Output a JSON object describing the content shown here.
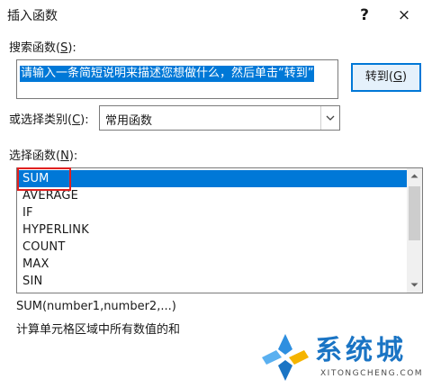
{
  "window": {
    "title": "插入函数",
    "help_glyph": "?",
    "close_glyph": "×"
  },
  "search": {
    "label": "搜索函数(",
    "mnemonic": "S",
    "label_end": "):",
    "value": "请输入一条简短说明来描述您想做什么，然后单击“转到”",
    "goto_label": "转到(",
    "goto_mnemonic": "G",
    "goto_end": ")"
  },
  "category": {
    "label": "或选择类别(",
    "mnemonic": "C",
    "label_end": "):",
    "selected": "常用函数",
    "arrow_icon": "chevron-down-icon"
  },
  "functions": {
    "label": "选择函数(",
    "mnemonic": "N",
    "label_end": "):",
    "items": [
      "SUM",
      "AVERAGE",
      "IF",
      "HYPERLINK",
      "COUNT",
      "MAX",
      "SIN"
    ],
    "selected_index": 0
  },
  "details": {
    "syntax": "SUM(number1,number2,...)",
    "description": "计算单元格区域中所有数值的和"
  },
  "watermark": {
    "brand": "系统城",
    "domain": "XITONGCHENG.COM"
  },
  "colors": {
    "accent": "#0078d7",
    "highlight_box": "#e02020",
    "watermark": "#1a74c4"
  }
}
